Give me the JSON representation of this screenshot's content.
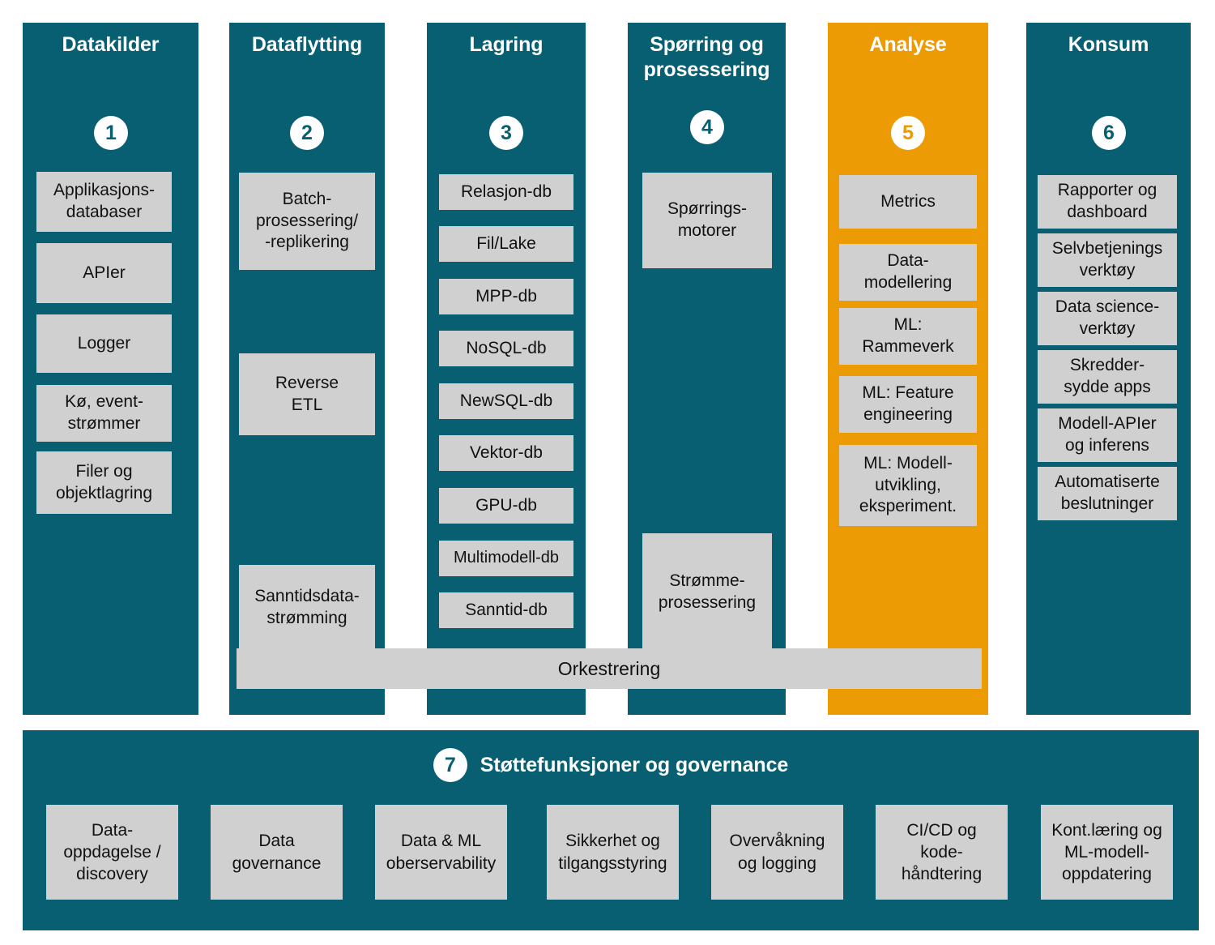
{
  "diagram": {
    "colors": {
      "teal": "#085f72",
      "amber": "#ed9b05",
      "chip_gray": "#d0d0d0",
      "text_dark": "#111111",
      "text_light": "#ffffff"
    },
    "columns": [
      {
        "number": "1",
        "title": "Datakilder",
        "accent": "teal",
        "items": [
          "Applikasjons-\ndatabaser",
          "APIer",
          "Logger",
          "Kø, event-\nstrømmer",
          "Filer og\nobjektlagring"
        ]
      },
      {
        "number": "2",
        "title": "Dataflytting",
        "accent": "teal",
        "items": [
          "Batch-\nprosessering/\n-replikering",
          "Reverse\nETL",
          "Sanntidsdata-\nstrømming"
        ]
      },
      {
        "number": "3",
        "title": "Lagring",
        "accent": "teal",
        "items": [
          "Relasjon-db",
          "Fil/Lake",
          "MPP-db",
          "NoSQL-db",
          "NewSQL-db",
          "Vektor-db",
          "GPU-db",
          "Multimodell-db",
          "Sanntid-db"
        ]
      },
      {
        "number": "4",
        "title": "Spørring og\nprosessering",
        "accent": "teal",
        "items": [
          "Spørrings-\nmotorer",
          "Strømme-\nprosessering"
        ]
      },
      {
        "number": "5",
        "title": "Analyse",
        "accent": "amber",
        "items": [
          "Metrics",
          "Data-\nmodellering",
          "ML:\nRammeverk",
          "ML: Feature\nengineering",
          "ML: Modell-\nutvikling,\neksperiment."
        ]
      },
      {
        "number": "6",
        "title": "Konsum",
        "accent": "teal",
        "items": [
          "Rapporter og\ndashboard",
          "Selvbetjenings\nverktøy",
          "Data science-\nverktøy",
          "Skredder-\nsydde apps",
          "Modell-APIer\nog inferens",
          "Automatiserte\nbeslutninger"
        ]
      }
    ],
    "orchestration": {
      "label": "Orkestrering"
    },
    "support": {
      "number": "7",
      "title": "Støttefunksjoner og governance",
      "items": [
        "Data-\noppdagelse /\ndiscovery",
        "Data\ngovernance",
        "Data & ML\noberservability",
        "Sikkerhet og\ntilgangsstyring",
        "Overvåkning\nog logging",
        "CI/CD og\nkode-\nhåndtering",
        "Kont.læring og\nML-modell-\noppdatering"
      ]
    }
  }
}
